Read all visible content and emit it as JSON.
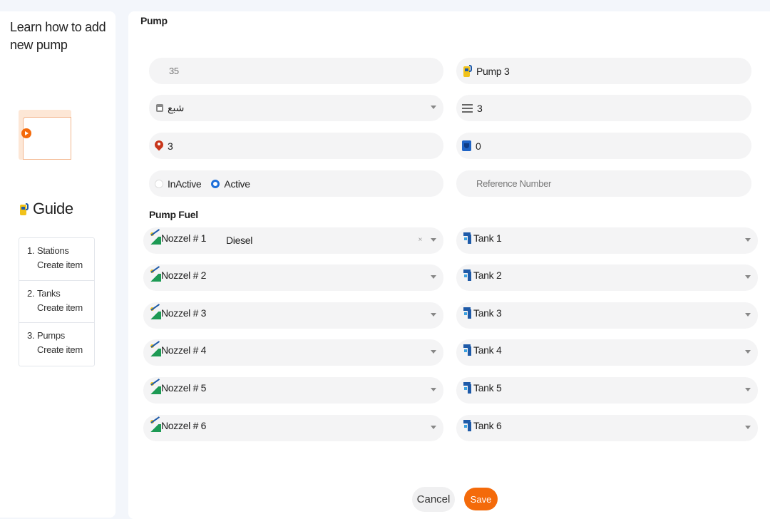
{
  "sidebar": {
    "learn_title": "Learn how to add new pump",
    "guide_title": "Guide",
    "steps": [
      {
        "num": "1.",
        "label": "Stations",
        "sub": "Create item"
      },
      {
        "num": "2.",
        "label": "Tanks",
        "sub": "Create item"
      },
      {
        "num": "3.",
        "label": "Pumps",
        "sub": "Create item"
      }
    ]
  },
  "form": {
    "section_title": "Pump",
    "number_value": "35",
    "pump_name": "Pump 3",
    "station_value": "شبع",
    "order_value": "3",
    "location_value": "3",
    "shield_value": "0",
    "status_inactive": "InActive",
    "status_active": "Active",
    "status_selected": "Active",
    "reference_placeholder": "Reference Number"
  },
  "fuel": {
    "section_title": "Pump Fuel",
    "nozzles": [
      {
        "label": "Nozzel # 1",
        "value": "Diesel",
        "tank": "Tank 1"
      },
      {
        "label": "Nozzel # 2",
        "value": "",
        "tank": "Tank 2"
      },
      {
        "label": "Nozzel # 3",
        "value": "",
        "tank": "Tank 3"
      },
      {
        "label": "Nozzel # 4",
        "value": "",
        "tank": "Tank 4"
      },
      {
        "label": "Nozzel # 5",
        "value": "",
        "tank": "Tank 5"
      },
      {
        "label": "Nozzel # 6",
        "value": "",
        "tank": "Tank 6"
      }
    ],
    "clear_symbol": "×"
  },
  "actions": {
    "cancel_label": "Cancel",
    "save_label": "Save"
  },
  "colors": {
    "accent": "#f46a0a",
    "radio_active": "#1e6fd9",
    "field_bg": "#f4f4f5"
  }
}
